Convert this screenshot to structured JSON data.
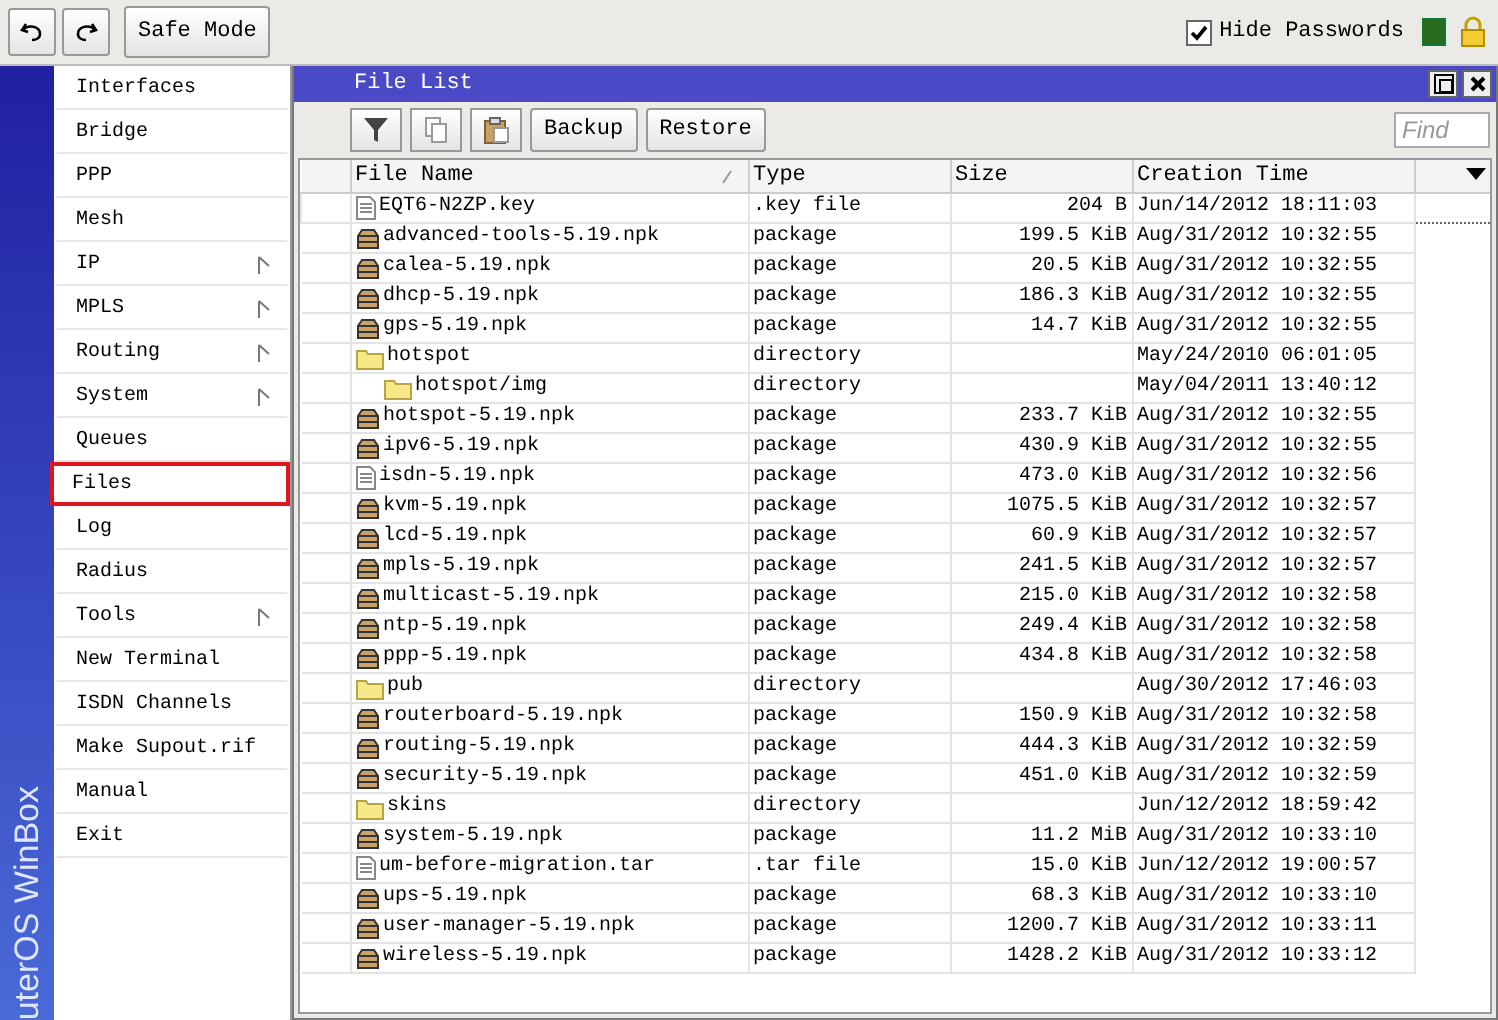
{
  "toolbar": {
    "safe_mode": "Safe Mode",
    "hide_passwords": {
      "label": "Hide Passwords",
      "checked": true
    }
  },
  "sidebar": {
    "brand": "uterOS WinBox",
    "items": [
      {
        "label": "Interfaces",
        "submenu": false,
        "highlighted": false
      },
      {
        "label": "Bridge",
        "submenu": false,
        "highlighted": false
      },
      {
        "label": "PPP",
        "submenu": false,
        "highlighted": false
      },
      {
        "label": "Mesh",
        "submenu": false,
        "highlighted": false
      },
      {
        "label": "IP",
        "submenu": true,
        "highlighted": false
      },
      {
        "label": "MPLS",
        "submenu": true,
        "highlighted": false
      },
      {
        "label": "Routing",
        "submenu": true,
        "highlighted": false
      },
      {
        "label": "System",
        "submenu": true,
        "highlighted": false
      },
      {
        "label": "Queues",
        "submenu": false,
        "highlighted": false
      },
      {
        "label": "Files",
        "submenu": false,
        "highlighted": true
      },
      {
        "label": "Log",
        "submenu": false,
        "highlighted": false
      },
      {
        "label": "Radius",
        "submenu": false,
        "highlighted": false
      },
      {
        "label": "Tools",
        "submenu": true,
        "highlighted": false
      },
      {
        "label": "New Terminal",
        "submenu": false,
        "highlighted": false
      },
      {
        "label": "ISDN Channels",
        "submenu": false,
        "highlighted": false
      },
      {
        "label": "Make Supout.rif",
        "submenu": false,
        "highlighted": false
      },
      {
        "label": "Manual",
        "submenu": false,
        "highlighted": false
      },
      {
        "label": "Exit",
        "submenu": false,
        "highlighted": false
      }
    ]
  },
  "window": {
    "title": "File List",
    "buttons": [
      "Backup",
      "Restore"
    ],
    "search": {
      "placeholder": "Find"
    },
    "table": {
      "columns": [
        "File Name",
        "Type",
        "Size",
        "Creation Time"
      ],
      "rows": [
        {
          "kind": "file",
          "name": "EQT6-N2ZP.key",
          "type": ".key file",
          "size": "204 B",
          "time": "Jun/14/2012 18:11:03",
          "selected": true
        },
        {
          "kind": "package",
          "name": "advanced-tools-5.19.npk",
          "type": "package",
          "size": "199.5 KiB",
          "time": "Aug/31/2012 10:32:55",
          "selected": false
        },
        {
          "kind": "package",
          "name": "calea-5.19.npk",
          "type": "package",
          "size": "20.5 KiB",
          "time": "Aug/31/2012 10:32:55",
          "selected": false
        },
        {
          "kind": "package",
          "name": "dhcp-5.19.npk",
          "type": "package",
          "size": "186.3 KiB",
          "time": "Aug/31/2012 10:32:55",
          "selected": false
        },
        {
          "kind": "package",
          "name": "gps-5.19.npk",
          "type": "package",
          "size": "14.7 KiB",
          "time": "Aug/31/2012 10:32:55",
          "selected": false
        },
        {
          "kind": "directory",
          "name": "hotspot",
          "type": "directory",
          "time": "May/24/2010 06:01:05",
          "selected": false,
          "children": [
            {
              "kind": "directory",
              "name": "hotspot/img",
              "type": "directory",
              "time": "May/04/2011 13:40:12",
              "selected": false
            }
          ]
        },
        {
          "kind": "package",
          "name": "hotspot-5.19.npk",
          "type": "package",
          "size": "233.7 KiB",
          "time": "Aug/31/2012 10:32:55",
          "selected": false
        },
        {
          "kind": "package",
          "name": "ipv6-5.19.npk",
          "type": "package",
          "size": "430.9 KiB",
          "time": "Aug/31/2012 10:32:55",
          "selected": false
        },
        {
          "kind": "file",
          "name": "isdn-5.19.npk",
          "type": "package",
          "size": "473.0 KiB",
          "time": "Aug/31/2012 10:32:56",
          "selected": false
        },
        {
          "kind": "package",
          "name": "kvm-5.19.npk",
          "type": "package",
          "size": "1075.5 KiB",
          "time": "Aug/31/2012 10:32:57",
          "selected": false
        },
        {
          "kind": "package",
          "name": "lcd-5.19.npk",
          "type": "package",
          "size": "60.9 KiB",
          "time": "Aug/31/2012 10:32:57",
          "selected": false
        },
        {
          "kind": "package",
          "name": "mpls-5.19.npk",
          "type": "package",
          "size": "241.5 KiB",
          "time": "Aug/31/2012 10:32:57",
          "selected": false
        },
        {
          "kind": "package",
          "name": "multicast-5.19.npk",
          "type": "package",
          "size": "215.0 KiB",
          "time": "Aug/31/2012 10:32:58",
          "selected": false
        },
        {
          "kind": "package",
          "name": "ntp-5.19.npk",
          "type": "package",
          "size": "249.4 KiB",
          "time": "Aug/31/2012 10:32:58",
          "selected": false
        },
        {
          "kind": "package",
          "name": "ppp-5.19.npk",
          "type": "package",
          "size": "434.8 KiB",
          "time": "Aug/31/2012 10:32:58",
          "selected": false
        },
        {
          "kind": "directory",
          "name": "pub",
          "type": "directory",
          "time": "Aug/30/2012 17:46:03",
          "selected": false
        },
        {
          "kind": "package",
          "name": "routerboard-5.19.npk",
          "type": "package",
          "size": "150.9 KiB",
          "time": "Aug/31/2012 10:32:58",
          "selected": false
        },
        {
          "kind": "package",
          "name": "routing-5.19.npk",
          "type": "package",
          "size": "444.3 KiB",
          "time": "Aug/31/2012 10:32:59",
          "selected": false
        },
        {
          "kind": "package",
          "name": "security-5.19.npk",
          "type": "package",
          "size": "451.0 KiB",
          "time": "Aug/31/2012 10:32:59",
          "selected": false
        },
        {
          "kind": "directory",
          "name": "skins",
          "type": "directory",
          "time": "Jun/12/2012 18:59:42",
          "selected": false
        },
        {
          "kind": "package",
          "name": "system-5.19.npk",
          "type": "package",
          "size": "11.2 MiB",
          "time": "Aug/31/2012 10:33:10",
          "selected": false
        },
        {
          "kind": "file",
          "name": "um-before-migration.tar",
          "type": ".tar file",
          "size": "15.0 KiB",
          "time": "Jun/12/2012 19:00:57",
          "selected": false
        },
        {
          "kind": "package",
          "name": "ups-5.19.npk",
          "type": "package",
          "size": "68.3 KiB",
          "time": "Aug/31/2012 10:33:10",
          "selected": false
        },
        {
          "kind": "package",
          "name": "user-manager-5.19.npk",
          "type": "package",
          "size": "1200.7 KiB",
          "time": "Aug/31/2012 10:33:11",
          "selected": false
        },
        {
          "kind": "package",
          "name": "wireless-5.19.npk",
          "type": "package",
          "size": "1428.2 KiB",
          "time": "Aug/31/2012 10:33:12",
          "selected": false
        }
      ]
    }
  }
}
